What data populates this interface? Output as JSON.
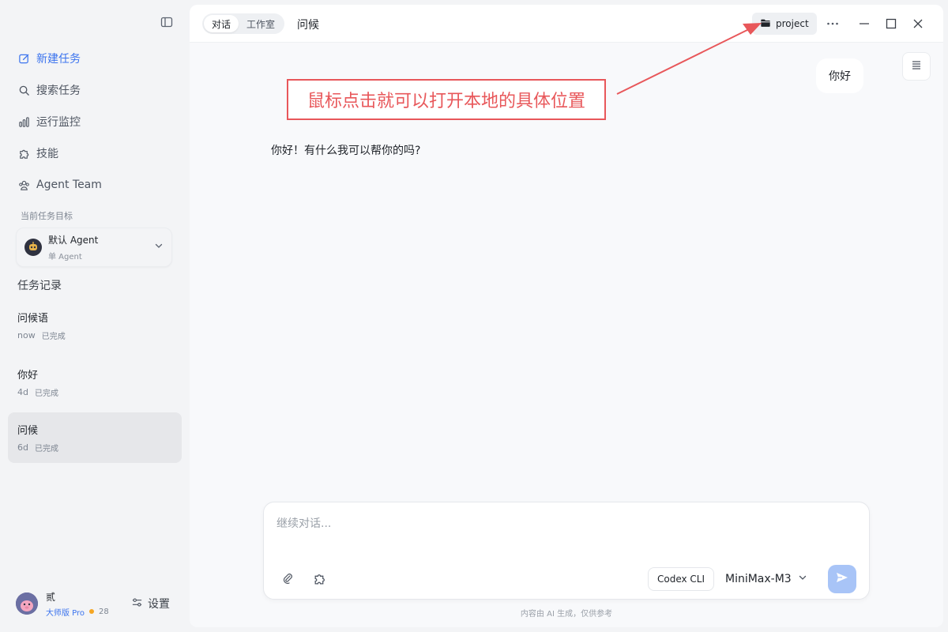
{
  "sidebar": {
    "nav": [
      {
        "label": "新建任务",
        "icon": "edit-icon"
      },
      {
        "label": "搜索任务",
        "icon": "search-icon"
      },
      {
        "label": "运行监控",
        "icon": "bar-chart-icon"
      },
      {
        "label": "技能",
        "icon": "puzzle-icon"
      },
      {
        "label": "Agent Team",
        "icon": "team-icon"
      }
    ],
    "current_goal_title": "当前任务目标",
    "agent": {
      "name": "默认 Agent",
      "sub": "单 Agent"
    },
    "history_title": "任务记录",
    "history": [
      {
        "name": "问候语",
        "time": "now",
        "status": "已完成"
      },
      {
        "name": "你好",
        "time": "4d",
        "status": "已完成"
      },
      {
        "name": "问候",
        "time": "6d",
        "status": "已完成"
      }
    ],
    "user": {
      "name": "贰",
      "plan": "大师版 Pro",
      "coins": "28"
    },
    "settings_label": "设置"
  },
  "topbar": {
    "tabs": [
      "对话",
      "工作室"
    ],
    "conversation_title": "问候",
    "project_label": "project"
  },
  "chat": {
    "user_message": "你好",
    "assistant_message": "你好！有什么我可以帮你的吗?"
  },
  "annotation": {
    "text": "鼠标点击就可以打开本地的具体位置",
    "color": "#e8575a"
  },
  "composer": {
    "placeholder": "继续对话...",
    "codex_label": "Codex CLI",
    "model": "MiniMax-M3"
  },
  "disclaimer": "内容由 AI 生成，仅供参考",
  "colors": {
    "accent": "#3b73ee",
    "send_disabled": "#a8c4f7",
    "annotation": "#e8575a"
  }
}
